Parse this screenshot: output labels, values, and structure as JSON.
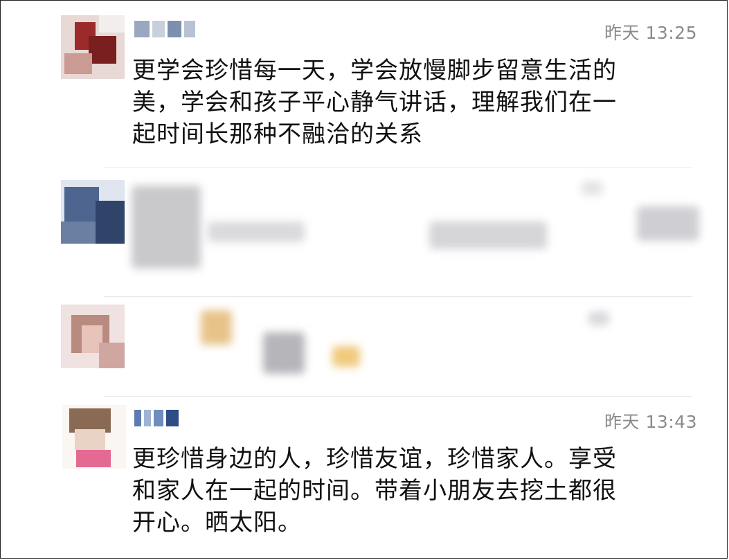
{
  "comments": [
    {
      "time": "昨天 13:25",
      "text_lines": [
        "更学会珍惜每一天，学会放慢脚步留意生活的",
        "美，学会和孩子平心静气讲话，理解我们在一",
        "起时间长那种不融洽的关系"
      ]
    },
    {
      "time": "昨天 13:43",
      "text_lines": [
        "更珍惜身边的人，珍惜友谊，珍惜家人。享受",
        "和家人在一起的时间。带着小朋友去挖土都很",
        "开心。晒太阳。"
      ]
    }
  ],
  "icons": {
    "avatar1": "avatar-pixelated",
    "avatar2": "avatar-pixelated",
    "avatar3": "avatar-pixelated",
    "avatar4": "avatar-pixelated"
  }
}
